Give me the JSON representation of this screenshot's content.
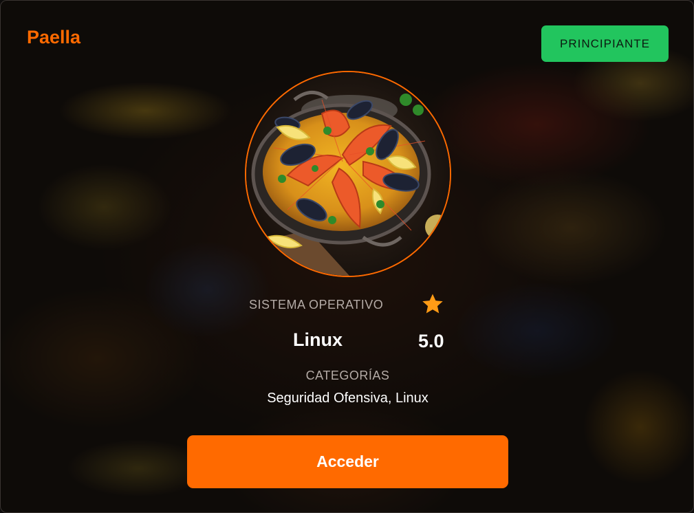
{
  "machine": {
    "name": "Paella",
    "difficulty": "PRINCIPIANTE",
    "os_label": "SISTEMA OPERATIVO",
    "os_value": "Linux",
    "rating": "5.0",
    "categories_label": "CATEGORÍAS",
    "categories_value": "Seguridad Ofensiva, Linux"
  },
  "actions": {
    "access_label": "Acceder"
  },
  "icons": {
    "rating": "star-icon",
    "image": "paella-dish-image"
  },
  "colors": {
    "accent": "#ff6a00",
    "difficulty_badge": "#22c55e",
    "star": "#ff9b16",
    "text_muted": "#b4aba6"
  }
}
